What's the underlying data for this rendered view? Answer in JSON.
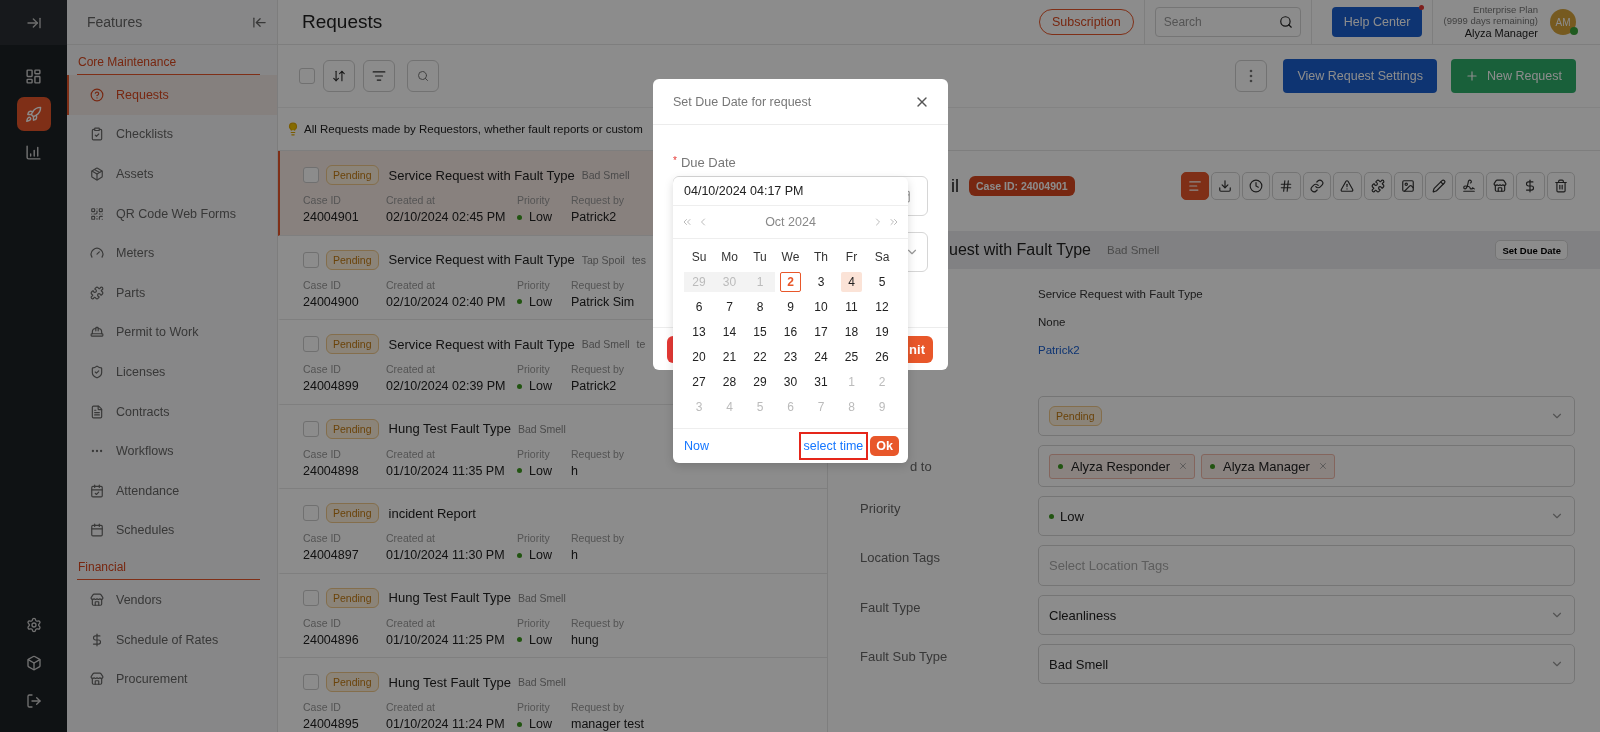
{
  "rail": {
    "top": [
      {
        "selected": false
      },
      {
        "selected": true
      },
      {
        "selected": false
      }
    ],
    "bottom": [
      {
        "selected": false
      },
      {
        "selected": false
      },
      {
        "selected": false
      }
    ]
  },
  "sidebar": {
    "title": "Features",
    "sections": [
      {
        "title": "Core Maintenance",
        "items": [
          {
            "label": "Requests",
            "selected": true
          },
          {
            "label": "Checklists",
            "selected": false
          },
          {
            "label": "Assets",
            "selected": false
          },
          {
            "label": "QR Code Web Forms",
            "selected": false
          },
          {
            "label": "Meters",
            "selected": false
          },
          {
            "label": "Parts",
            "selected": false
          },
          {
            "label": "Permit to Work",
            "selected": false
          },
          {
            "label": "Licenses",
            "selected": false
          },
          {
            "label": "Contracts",
            "selected": false
          },
          {
            "label": "Workflows",
            "selected": false
          },
          {
            "label": "Attendance",
            "selected": false
          },
          {
            "label": "Schedules",
            "selected": false
          }
        ]
      },
      {
        "title": "Financial",
        "items": [
          {
            "label": "Vendors",
            "selected": false
          },
          {
            "label": "Schedule of Rates",
            "selected": false
          },
          {
            "label": "Procurement",
            "selected": false
          }
        ]
      }
    ]
  },
  "header": {
    "title": "Requests",
    "subscription": "Subscription",
    "search": {
      "placeholder": "Search"
    },
    "help": "Help Center",
    "help_notification": true,
    "plan": "Enterprise Plan",
    "plan_note": "(9999 days remaining)",
    "user": "Alyza Manager",
    "avatar": "AM",
    "online": true
  },
  "toolbar": {
    "select_all": false,
    "settings_button": "View Request Settings",
    "new_button": "New Request"
  },
  "banner": "All Requests made by Requestors, whether fault reports or custom",
  "requests": [
    {
      "selected": true,
      "checked": false,
      "status": "Pending",
      "title": "Service Request with Fault Type",
      "tags": [
        "Bad Smell"
      ],
      "fields": [
        {
          "label": "Case ID",
          "value": "24004901"
        },
        {
          "label": "Created at",
          "value": "02/10/2024 02:45 PM"
        },
        {
          "label": "Priority",
          "value": "Low",
          "kind": "priority"
        },
        {
          "label": "Request by",
          "value": "Patrick2"
        }
      ]
    },
    {
      "selected": false,
      "checked": false,
      "status": "Pending",
      "title": "Service Request with Fault Type",
      "tags": [
        "Tap Spoil",
        "tes"
      ],
      "fields": [
        {
          "label": "Case ID",
          "value": "24004900"
        },
        {
          "label": "Created at",
          "value": "02/10/2024 02:40 PM"
        },
        {
          "label": "Priority",
          "value": "Low",
          "kind": "priority"
        },
        {
          "label": "Request by",
          "value": "Patrick Sim"
        }
      ]
    },
    {
      "selected": false,
      "checked": false,
      "status": "Pending",
      "title": "Service Request with Fault Type",
      "tags": [
        "Bad Smell",
        "te"
      ],
      "fields": [
        {
          "label": "Case ID",
          "value": "24004899"
        },
        {
          "label": "Created at",
          "value": "02/10/2024 02:39 PM"
        },
        {
          "label": "Priority",
          "value": "Low",
          "kind": "priority"
        },
        {
          "label": "Request by",
          "value": "Patrick2"
        }
      ]
    },
    {
      "selected": false,
      "checked": false,
      "status": "Pending",
      "title": "Hung Test Fault Type",
      "tags": [
        "Bad Smell"
      ],
      "fields": [
        {
          "label": "Case ID",
          "value": "24004898"
        },
        {
          "label": "Created at",
          "value": "01/10/2024 11:35 PM"
        },
        {
          "label": "Priority",
          "value": "Low",
          "kind": "priority"
        },
        {
          "label": "Request by",
          "value": "h"
        }
      ]
    },
    {
      "selected": false,
      "checked": false,
      "status": "Pending",
      "title": "incident Report",
      "fields": [
        {
          "label": "Case ID",
          "value": "24004897"
        },
        {
          "label": "Created at",
          "value": "01/10/2024 11:30 PM"
        },
        {
          "label": "Priority",
          "value": "Low",
          "kind": "priority"
        },
        {
          "label": "Request by",
          "value": "h"
        }
      ]
    },
    {
      "selected": false,
      "checked": false,
      "status": "Pending",
      "title": "Hung Test Fault Type",
      "tags": [
        "Bad Smell"
      ],
      "fields": [
        {
          "label": "Case ID",
          "value": "24004896"
        },
        {
          "label": "Created at",
          "value": "01/10/2024 11:25 PM"
        },
        {
          "label": "Priority",
          "value": "Low",
          "kind": "priority"
        },
        {
          "label": "Request by",
          "value": "hung"
        }
      ]
    },
    {
      "selected": false,
      "checked": false,
      "status": "Pending",
      "title": "Hung Test Fault Type",
      "tags": [
        "Bad Smell"
      ],
      "fields": [
        {
          "label": "Case ID",
          "value": "24004895"
        },
        {
          "label": "Created at",
          "value": "01/10/2024 11:24 PM"
        },
        {
          "label": "Priority",
          "value": "Low",
          "kind": "priority"
        },
        {
          "label": "Request by",
          "value": "manager test"
        }
      ]
    }
  ],
  "detail": {
    "title": "il",
    "case_badge": "Case ID: 24004901",
    "tools": [
      {
        "selected": true
      },
      {
        "selected": false
      },
      {
        "selected": false
      },
      {
        "selected": false
      },
      {
        "selected": false
      },
      {
        "selected": false
      },
      {
        "selected": false
      },
      {
        "selected": false
      },
      {
        "selected": false
      },
      {
        "selected": false
      },
      {
        "selected": false
      },
      {
        "selected": false
      },
      {
        "selected": false
      }
    ],
    "heading": "uest with Fault Type",
    "heading_tag": "Bad Smell",
    "due_button": "Set Due Date",
    "info": [
      {
        "kind": "text",
        "value": "Service Request with Fault Type"
      },
      {
        "kind": "text",
        "value": "None"
      },
      {
        "kind": "link",
        "value": "Patrick2"
      }
    ],
    "fields": [
      {
        "kind": "badge",
        "value": "Pending"
      },
      {
        "kind": "tags",
        "label": "d to",
        "tags": [
          "Alyza Responder",
          "Alyza Manager"
        ]
      },
      {
        "kind": "priority",
        "label": "Priority",
        "value": "Low"
      },
      {
        "kind": "placeholder",
        "label": "Location Tags",
        "placeholder": "Select Location Tags"
      },
      {
        "kind": "select",
        "label": "Fault Type",
        "value": "Cleanliness"
      },
      {
        "kind": "select",
        "label": "Fault Sub Type",
        "value": "Bad Smell"
      }
    ]
  },
  "modal": {
    "title": "Set Due Date for request",
    "field_label": "Due Date",
    "required_mark": "*",
    "submit_label": "nit"
  },
  "datepicker": {
    "value": "04/10/2024 04:17 PM",
    "month": "Oct 2024",
    "weekdays": [
      "Su",
      "Mo",
      "Tu",
      "We",
      "Th",
      "Fr",
      "Sa"
    ],
    "weeks": [
      [
        {
          "label": "29",
          "kind": "disabled",
          "selected": false
        },
        {
          "label": "30",
          "kind": "disabled",
          "selected": false
        },
        {
          "label": "1",
          "kind": "disabled",
          "selected": false
        },
        {
          "label": "2",
          "kind": "today",
          "selected": false
        },
        {
          "label": "3",
          "kind": "day",
          "selected": false
        },
        {
          "label": "4",
          "kind": "day",
          "selected": true
        },
        {
          "label": "5",
          "kind": "day",
          "selected": false
        }
      ],
      [
        {
          "label": "6",
          "kind": "day",
          "selected": false
        },
        {
          "label": "7",
          "kind": "day",
          "selected": false
        },
        {
          "label": "8",
          "kind": "day",
          "selected": false
        },
        {
          "label": "9",
          "kind": "day",
          "selected": false
        },
        {
          "label": "10",
          "kind": "day",
          "selected": false
        },
        {
          "label": "11",
          "kind": "day",
          "selected": false
        },
        {
          "label": "12",
          "kind": "day",
          "selected": false
        }
      ],
      [
        {
          "label": "13",
          "kind": "day",
          "selected": false
        },
        {
          "label": "14",
          "kind": "day",
          "selected": false
        },
        {
          "label": "15",
          "kind": "day",
          "selected": false
        },
        {
          "label": "16",
          "kind": "day",
          "selected": false
        },
        {
          "label": "17",
          "kind": "day",
          "selected": false
        },
        {
          "label": "18",
          "kind": "day",
          "selected": false
        },
        {
          "label": "19",
          "kind": "day",
          "selected": false
        }
      ],
      [
        {
          "label": "20",
          "kind": "day",
          "selected": false
        },
        {
          "label": "21",
          "kind": "day",
          "selected": false
        },
        {
          "label": "22",
          "kind": "day",
          "selected": false
        },
        {
          "label": "23",
          "kind": "day",
          "selected": false
        },
        {
          "label": "24",
          "kind": "day",
          "selected": false
        },
        {
          "label": "25",
          "kind": "day",
          "selected": false
        },
        {
          "label": "26",
          "kind": "day",
          "selected": false
        }
      ],
      [
        {
          "label": "27",
          "kind": "day",
          "selected": false
        },
        {
          "label": "28",
          "kind": "day",
          "selected": false
        },
        {
          "label": "29",
          "kind": "day",
          "selected": false
        },
        {
          "label": "30",
          "kind": "day",
          "selected": false
        },
        {
          "label": "31",
          "kind": "day",
          "selected": false
        },
        {
          "label": "1",
          "kind": "other",
          "selected": false
        },
        {
          "label": "2",
          "kind": "other",
          "selected": false
        }
      ],
      [
        {
          "label": "3",
          "kind": "other",
          "selected": false
        },
        {
          "label": "4",
          "kind": "other",
          "selected": false
        },
        {
          "label": "5",
          "kind": "other",
          "selected": false
        },
        {
          "label": "6",
          "kind": "other",
          "selected": false
        },
        {
          "label": "7",
          "kind": "other",
          "selected": false
        },
        {
          "label": "8",
          "kind": "other",
          "selected": false
        },
        {
          "label": "9",
          "kind": "other",
          "selected": false
        }
      ]
    ],
    "now": "Now",
    "select_time": {
      "label": "select time",
      "highlighted": true
    },
    "ok": "Ok"
  }
}
